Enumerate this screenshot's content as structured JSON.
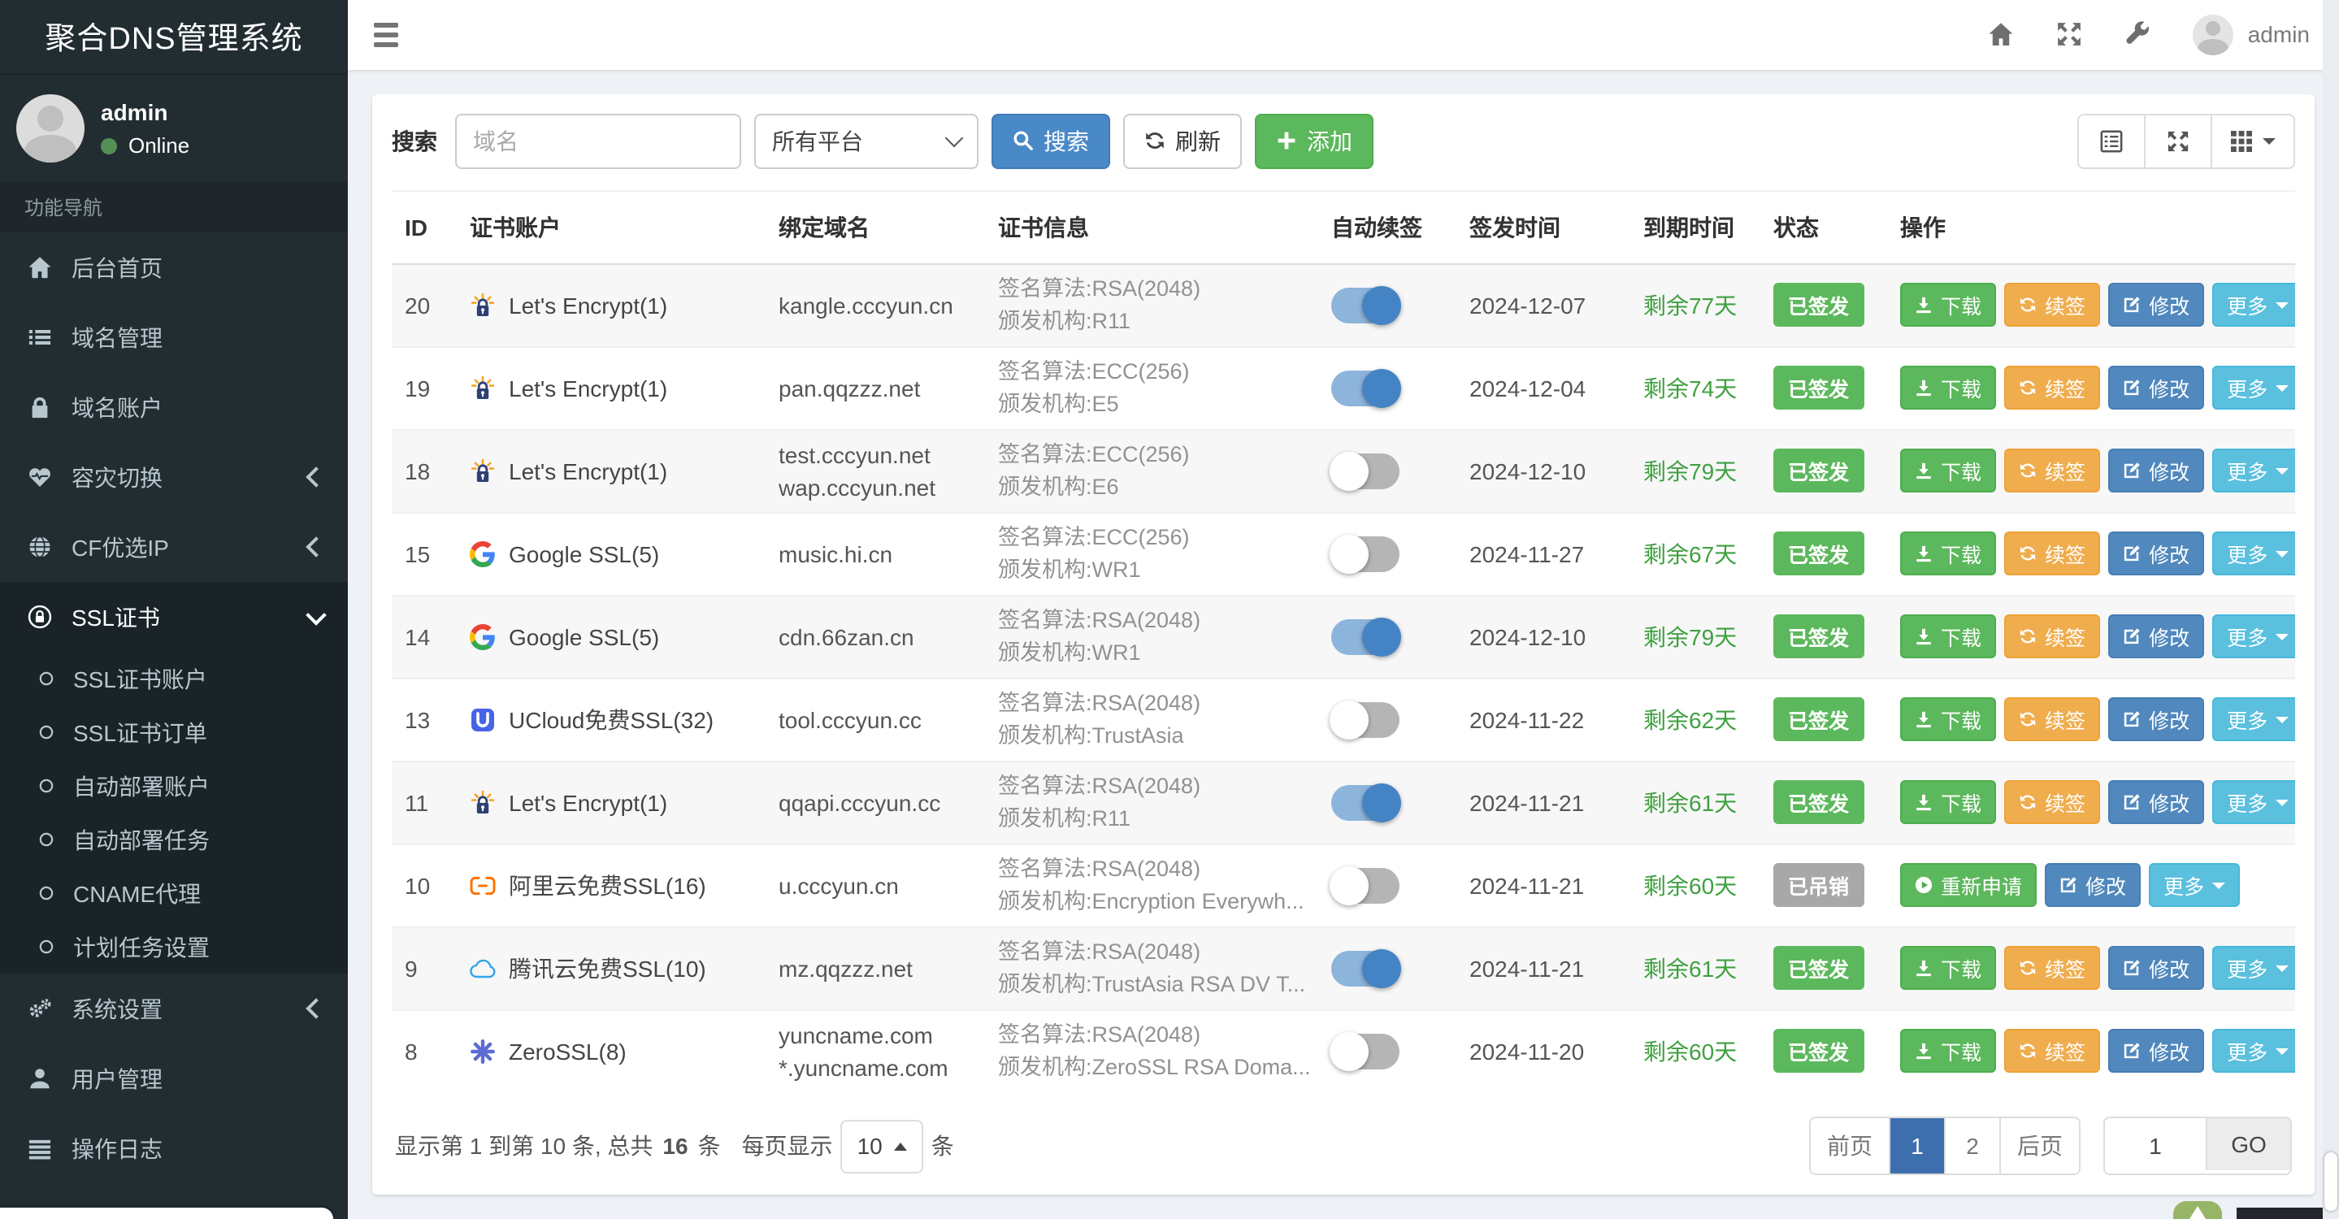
{
  "app": {
    "title": "聚合DNS管理系统"
  },
  "topbar": {
    "username": "admin"
  },
  "sidebar": {
    "user_name": "admin",
    "user_status": "Online",
    "section_label": "功能导航",
    "items": [
      {
        "key": "dashboard",
        "icon": "home",
        "label": "后台首页"
      },
      {
        "key": "domain-manage",
        "icon": "list",
        "label": "域名管理"
      },
      {
        "key": "domain-accounts",
        "icon": "lock",
        "label": "域名账户"
      },
      {
        "key": "failover",
        "icon": "heartbeat",
        "label": "容灾切换",
        "arrow": "left"
      },
      {
        "key": "cf-ip",
        "icon": "globe",
        "label": "CF优选IP",
        "arrow": "left"
      },
      {
        "key": "ssl-cert",
        "icon": "ssl",
        "label": "SSL证书",
        "arrow": "down",
        "active": true,
        "children": [
          {
            "key": "ssl-accounts",
            "label": "SSL证书账户"
          },
          {
            "key": "ssl-orders",
            "label": "SSL证书订单"
          },
          {
            "key": "deploy-accounts",
            "label": "自动部署账户"
          },
          {
            "key": "deploy-tasks",
            "label": "自动部署任务"
          },
          {
            "key": "cname-proxy",
            "label": "CNAME代理"
          },
          {
            "key": "cron-settings",
            "label": "计划任务设置"
          }
        ]
      },
      {
        "key": "system-settings",
        "icon": "gears",
        "label": "系统设置",
        "arrow": "left"
      },
      {
        "key": "user-manage",
        "icon": "user",
        "label": "用户管理"
      },
      {
        "key": "op-logs",
        "icon": "logs",
        "label": "操作日志"
      }
    ]
  },
  "toolbar": {
    "search_label": "搜索",
    "search_placeholder": "域名",
    "platform_value": "所有平台",
    "search_button": "搜索",
    "refresh_button": "刷新",
    "add_button": "添加"
  },
  "table": {
    "columns": [
      "ID",
      "证书账户",
      "绑定域名",
      "证书信息",
      "自动续签",
      "签发时间",
      "到期时间",
      "状态",
      "操作"
    ],
    "action_labels": {
      "download": "下载",
      "renew": "续签",
      "edit": "修改",
      "more": "更多",
      "reapply": "重新申请"
    },
    "rows": [
      {
        "id": "20",
        "provider": "letsencrypt",
        "account": "Let's Encrypt(1)",
        "domains": [
          "kangle.cccyun.cn"
        ],
        "algo": "签名算法:RSA(2048)",
        "issuer": "颁发机构:R11",
        "auto_renew": true,
        "issued": "2024-12-07",
        "days_left": "剩余77天",
        "status": "已签发",
        "status_type": "issued",
        "actions": [
          "download",
          "renew",
          "edit",
          "more"
        ]
      },
      {
        "id": "19",
        "provider": "letsencrypt",
        "account": "Let's Encrypt(1)",
        "domains": [
          "pan.qqzzz.net"
        ],
        "algo": "签名算法:ECC(256)",
        "issuer": "颁发机构:E5",
        "auto_renew": true,
        "issued": "2024-12-04",
        "days_left": "剩余74天",
        "status": "已签发",
        "status_type": "issued",
        "actions": [
          "download",
          "renew",
          "edit",
          "more"
        ]
      },
      {
        "id": "18",
        "provider": "letsencrypt",
        "account": "Let's Encrypt(1)",
        "domains": [
          "test.cccyun.net",
          "wap.cccyun.net"
        ],
        "algo": "签名算法:ECC(256)",
        "issuer": "颁发机构:E6",
        "auto_renew": false,
        "issued": "2024-12-10",
        "days_left": "剩余79天",
        "status": "已签发",
        "status_type": "issued",
        "actions": [
          "download",
          "renew",
          "edit",
          "more"
        ]
      },
      {
        "id": "15",
        "provider": "google",
        "account": "Google SSL(5)",
        "domains": [
          "music.hi.cn"
        ],
        "algo": "签名算法:ECC(256)",
        "issuer": "颁发机构:WR1",
        "auto_renew": false,
        "issued": "2024-11-27",
        "days_left": "剩余67天",
        "status": "已签发",
        "status_type": "issued",
        "actions": [
          "download",
          "renew",
          "edit",
          "more"
        ]
      },
      {
        "id": "14",
        "provider": "google",
        "account": "Google SSL(5)",
        "domains": [
          "cdn.66zan.cn"
        ],
        "algo": "签名算法:RSA(2048)",
        "issuer": "颁发机构:WR1",
        "auto_renew": true,
        "issued": "2024-12-10",
        "days_left": "剩余79天",
        "status": "已签发",
        "status_type": "issued",
        "actions": [
          "download",
          "renew",
          "edit",
          "more"
        ]
      },
      {
        "id": "13",
        "provider": "ucloud",
        "account": "UCloud免费SSL(32)",
        "domains": [
          "tool.cccyun.cc"
        ],
        "algo": "签名算法:RSA(2048)",
        "issuer": "颁发机构:TrustAsia",
        "auto_renew": false,
        "issued": "2024-11-22",
        "days_left": "剩余62天",
        "status": "已签发",
        "status_type": "issued",
        "actions": [
          "download",
          "renew",
          "edit",
          "more"
        ]
      },
      {
        "id": "11",
        "provider": "letsencrypt",
        "account": "Let's Encrypt(1)",
        "domains": [
          "qqapi.cccyun.cc"
        ],
        "algo": "签名算法:RSA(2048)",
        "issuer": "颁发机构:R11",
        "auto_renew": true,
        "issued": "2024-11-21",
        "days_left": "剩余61天",
        "status": "已签发",
        "status_type": "issued",
        "actions": [
          "download",
          "renew",
          "edit",
          "more"
        ]
      },
      {
        "id": "10",
        "provider": "aliyun",
        "account": "阿里云免费SSL(16)",
        "domains": [
          "u.cccyun.cn"
        ],
        "algo": "签名算法:RSA(2048)",
        "issuer": "颁发机构:Encryption Everywh...",
        "auto_renew": false,
        "issued": "2024-11-21",
        "days_left": "剩余60天",
        "status": "已吊销",
        "status_type": "revoked",
        "actions": [
          "reapply",
          "edit",
          "more"
        ]
      },
      {
        "id": "9",
        "provider": "tencent",
        "account": "腾讯云免费SSL(10)",
        "domains": [
          "mz.qqzzz.net"
        ],
        "algo": "签名算法:RSA(2048)",
        "issuer": "颁发机构:TrustAsia RSA DV T...",
        "auto_renew": true,
        "issued": "2024-11-21",
        "days_left": "剩余61天",
        "status": "已签发",
        "status_type": "issued",
        "actions": [
          "download",
          "renew",
          "edit",
          "more"
        ]
      },
      {
        "id": "8",
        "provider": "zerossl",
        "account": "ZeroSSL(8)",
        "domains": [
          "yuncname.com",
          "*.yuncname.com"
        ],
        "algo": "签名算法:RSA(2048)",
        "issuer": "颁发机构:ZeroSSL RSA Doma...",
        "auto_renew": false,
        "issued": "2024-11-20",
        "days_left": "剩余60天",
        "status": "已签发",
        "status_type": "issued",
        "actions": [
          "download",
          "renew",
          "edit",
          "more"
        ]
      }
    ]
  },
  "pagination": {
    "info_prefix": "显示第 1 到第 10 条, 总共",
    "total": "16",
    "info_suffix": "条",
    "per_page_label": "每页显示",
    "page_size": "10",
    "per_page_suffix": "条",
    "prev_label": "前页",
    "pages": [
      "1",
      "2"
    ],
    "active_page": "1",
    "next_label": "后页",
    "goto_value": "1",
    "go_label": "GO"
  },
  "colors": {
    "sidebar_bg": "#222d32",
    "primary": "#4a89c8",
    "success": "#5cb85c",
    "warning": "#f0ad4e",
    "info": "#5bc0de",
    "revoked_gray": "#a8a8a8",
    "days_green": "#3fa03f",
    "active_page_blue": "#3d6fae"
  }
}
